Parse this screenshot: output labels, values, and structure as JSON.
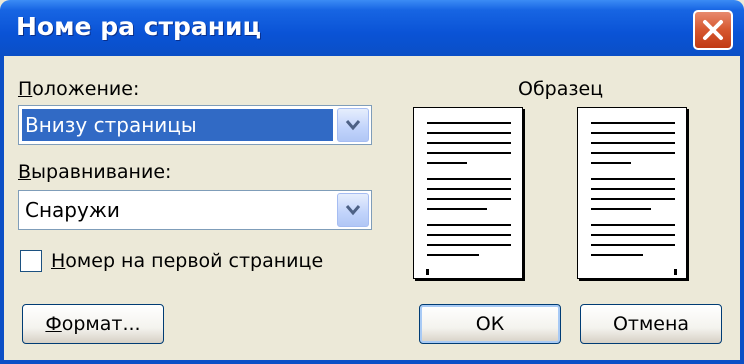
{
  "window": {
    "title": "Номе ра страниц"
  },
  "position": {
    "label_first": "П",
    "label_rest": "оложение:",
    "value": "Внизу страницы"
  },
  "alignment": {
    "label_first": "В",
    "label_rest": "ыравнивание:",
    "value": "Снаружи"
  },
  "first_page": {
    "label_first": "Н",
    "label_rest": "омер на первой странице",
    "checked": false
  },
  "preview": {
    "label": "Образец"
  },
  "buttons": {
    "format_first": "Ф",
    "format_rest": "ормат...",
    "ok": "ОК",
    "cancel": "Отмена"
  },
  "colors": {
    "titlebar": "#0b4fc6",
    "selection": "#316ac5",
    "dialog_bg": "#ece9d8"
  }
}
